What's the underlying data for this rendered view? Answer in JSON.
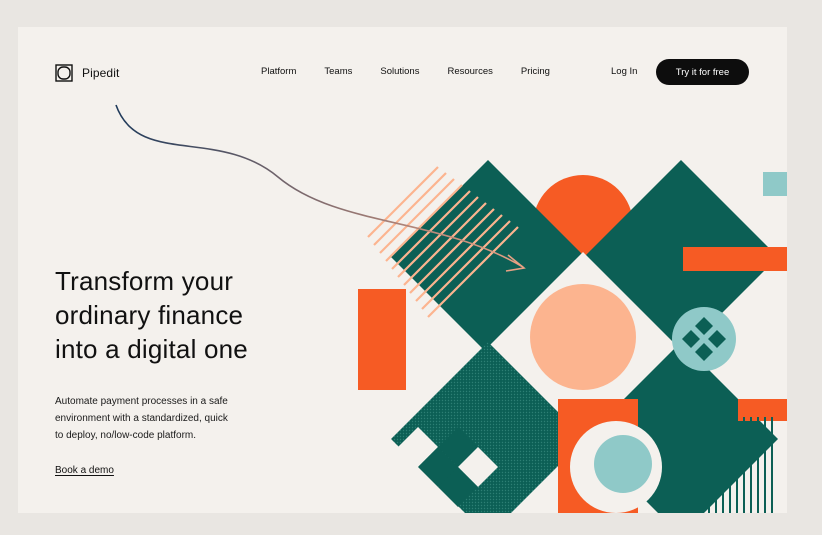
{
  "brand": {
    "name": "Pipedit",
    "logo_icon": "rounded-square-icon"
  },
  "nav": {
    "items": [
      "Platform",
      "Teams",
      "Solutions",
      "Resources",
      "Pricing"
    ],
    "login_label": "Log In",
    "cta_label": "Try it for free"
  },
  "hero": {
    "title_lines": [
      "Transform your",
      "ordinary finance",
      "into a digital one"
    ],
    "subtitle_lines": [
      "Automate payment processes in a safe",
      "environment with a standardized, quick",
      "to deploy, no/low-code platform."
    ],
    "demo_label": "Book a demo"
  },
  "colors": {
    "background": "#f4f1ed",
    "teal": "#0c5f55",
    "orange": "#f65b24",
    "peach": "#fcb48f",
    "light_teal": "#8fc9c8",
    "black": "#0d0d0d"
  }
}
